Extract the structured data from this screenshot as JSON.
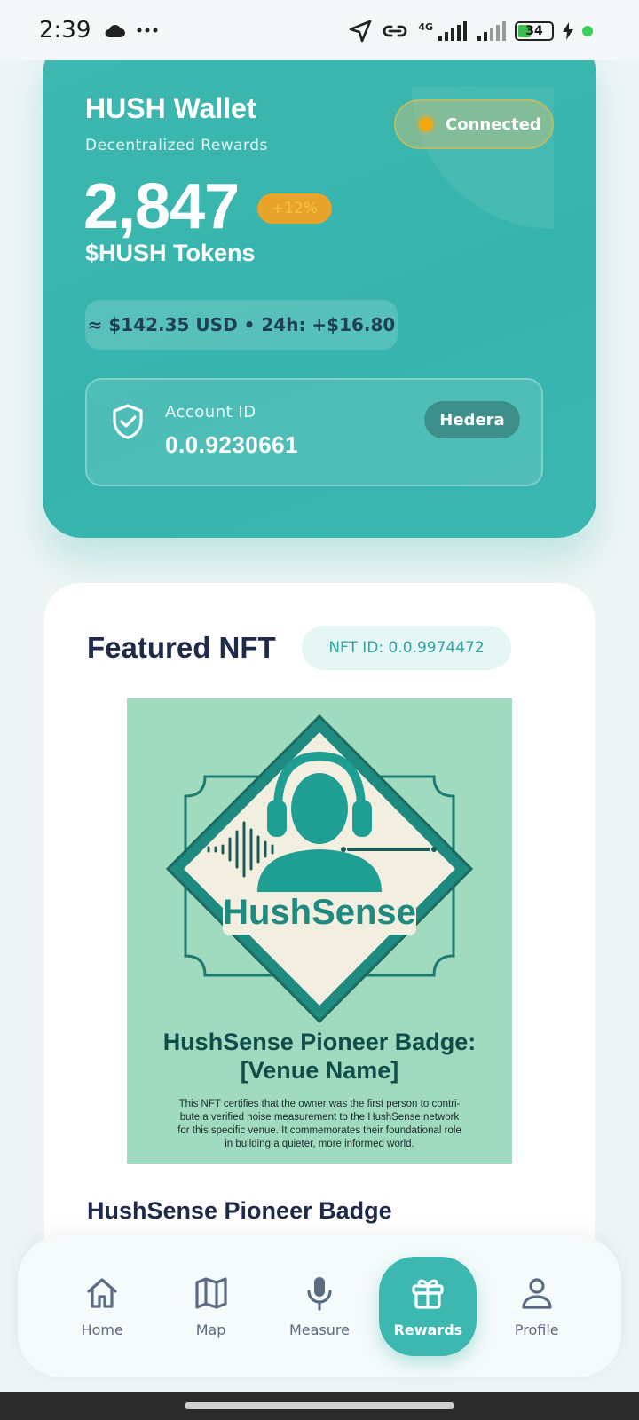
{
  "status_bar": {
    "time": "2:39",
    "network": "4G",
    "battery": "34"
  },
  "wallet": {
    "title": "HUSH Wallet",
    "subtitle": "Decentralized Rewards",
    "status": "Connected",
    "amount": "2,847",
    "change": "+12%",
    "token_label": "$HUSH Tokens",
    "usd_summary": "≈ $142.35 USD • 24h: +$16.80",
    "account_label": "Account ID",
    "account_id": "0.0.9230661",
    "network_badge": "Hedera"
  },
  "nft": {
    "section_title": "Featured NFT",
    "nft_id": "NFT ID: 0.0.9974472",
    "image": {
      "brand": "HushSense",
      "badge_title_line1": "HushSense Pioneer Badge:",
      "badge_title_line2": "[Venue Name]",
      "description_lines": [
        "This NFT certifies that the owner was the first person to contri-",
        "bute a verified noise measurement to the HushSense network",
        "for this specific venue. It commemorates their foundational role",
        "in building a quieter, more informed world."
      ]
    },
    "name": "HushSense Pioneer Badge"
  },
  "nav": {
    "items": [
      {
        "label": "Home",
        "icon": "home-icon"
      },
      {
        "label": "Map",
        "icon": "map-icon"
      },
      {
        "label": "Measure",
        "icon": "microphone-icon"
      },
      {
        "label": "Rewards",
        "icon": "gift-icon",
        "active": true
      },
      {
        "label": "Profile",
        "icon": "user-icon"
      }
    ]
  },
  "colors": {
    "primary": "#3db8b0",
    "accent": "#f3a712",
    "text_dark": "#1e2a4a"
  }
}
